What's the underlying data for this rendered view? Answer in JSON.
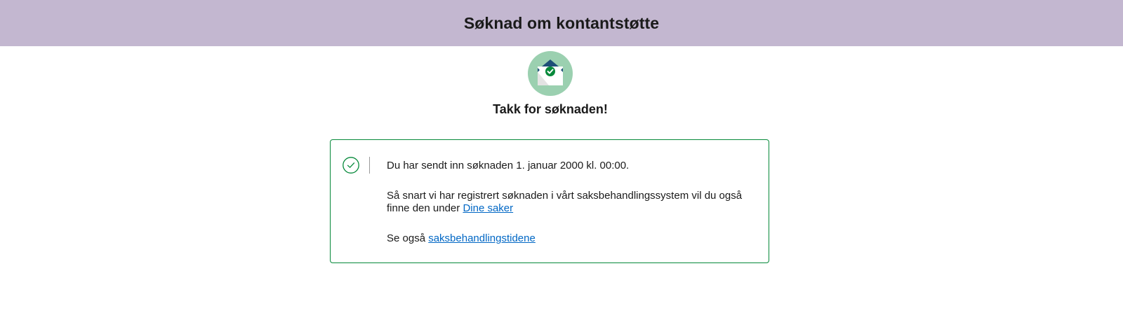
{
  "header": {
    "title": "Søknad om kontantstøtte"
  },
  "illustration": {
    "icon": "envelope-check-icon",
    "circle_color": "#9bd0b0",
    "check_color": "#06893a"
  },
  "confirmation": {
    "title": "Takk for søknaden!"
  },
  "alert": {
    "type": "success",
    "border_color": "#06893a",
    "icon": "success-check-icon",
    "sent_text": "Du har sendt inn søknaden 1. januar 2000 kl. 00:00.",
    "registered_text": "Så snart vi har registrert søknaden i vårt saksbehandlingssystem vil du også finne den under",
    "dine_saker_link": "Dine saker",
    "see_also_text": "Se også",
    "processing_times_link": "saksbehandlingstidene",
    "link_color": "#0067c5"
  }
}
